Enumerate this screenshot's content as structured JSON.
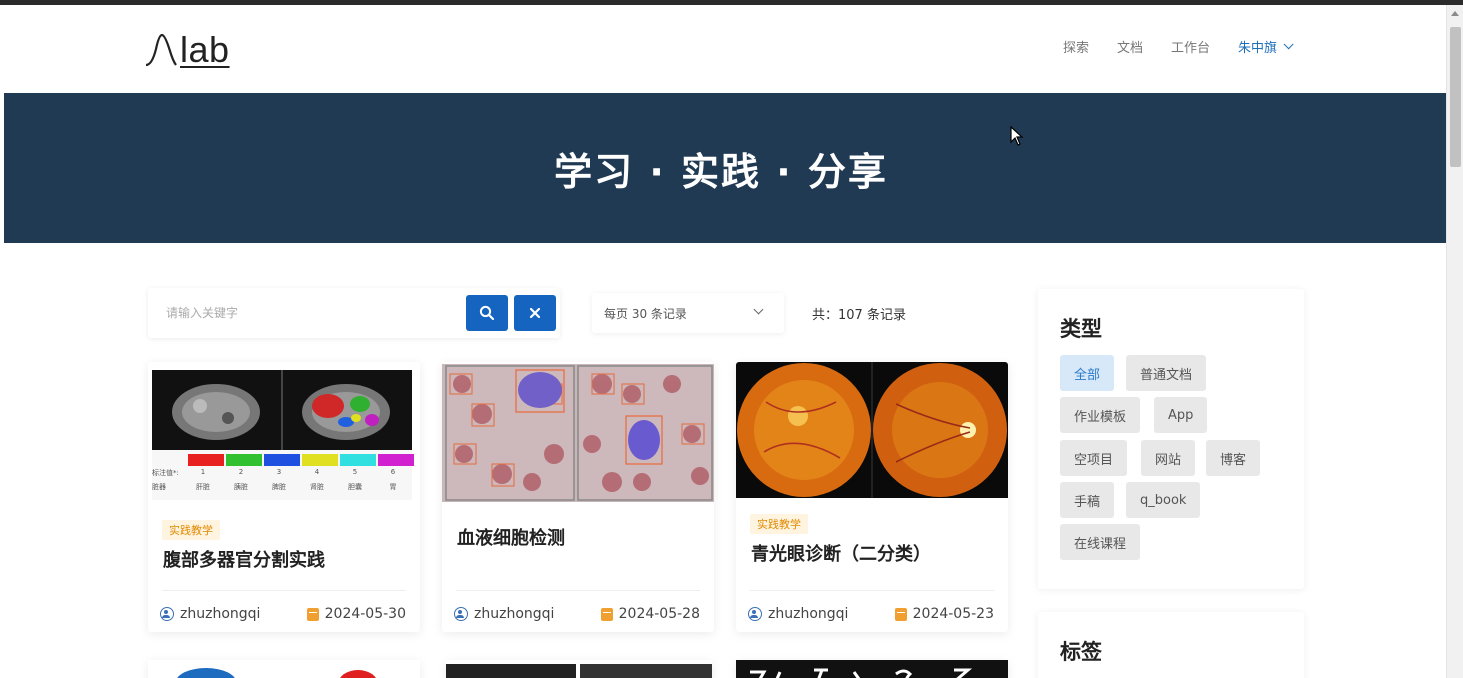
{
  "brand": {
    "logo_text": "lab"
  },
  "nav": {
    "items": [
      "探索",
      "文档",
      "工作台"
    ],
    "user": "朱中旗"
  },
  "hero": {
    "title": "学习 · 实践 · 分享"
  },
  "search": {
    "placeholder": "请输入关键字",
    "search_icon": "search-icon",
    "clear_icon": "close-icon"
  },
  "pagination": {
    "per_page_label": "每页 30 条记录",
    "total_label": "共：107 条记录"
  },
  "cards": [
    {
      "tag": "实践教学",
      "title": "腹部多器官分割实践",
      "author": "zhuzhongqi",
      "date": "2024-05-30"
    },
    {
      "tag": "",
      "title": "血液细胞检测",
      "author": "zhuzhongqi",
      "date": "2024-05-28"
    },
    {
      "tag": "实践教学",
      "title": "青光眼诊断（二分类）",
      "author": "zhuzhongqi",
      "date": "2024-05-23"
    }
  ],
  "organ_legend": {
    "values": [
      "标注值*:",
      "1",
      "2",
      "3",
      "4",
      "5",
      "6"
    ],
    "organs": [
      "脏器",
      "肝脏",
      "胰脏",
      "脾脏",
      "肾脏",
      "胆囊",
      "胃"
    ],
    "colors": [
      "#e82020",
      "#30c030",
      "#2050e0",
      "#e0e020",
      "#30e0e0",
      "#d020d0"
    ]
  },
  "sidebar": {
    "type_title": "类型",
    "types": [
      "全部",
      "普通文档",
      "作业模板",
      "App",
      "空项目",
      "网站",
      "博客",
      "手稿",
      "q_book",
      "在线课程"
    ],
    "active_type": "全部",
    "tag_title": "标签"
  },
  "colors": {
    "hero_bg": "#203a53",
    "primary": "#1565c0",
    "accent_tag": "#e08a00"
  }
}
